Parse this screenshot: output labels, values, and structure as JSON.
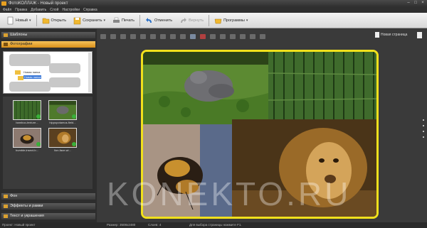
{
  "window": {
    "title": "ФотоКОЛЛАЖ - Новый проект"
  },
  "menu": [
    "Файл",
    "Правка",
    "Добавить",
    "Слой",
    "Настройки",
    "Справка"
  ],
  "toolbar": {
    "new_label": "Новый",
    "open_label": "Открыть",
    "save_label": "Сохранить",
    "print_label": "Печать",
    "undo_label": "Отменить",
    "redo_label": "Вернуть",
    "programs_label": "Программы"
  },
  "left_panel": {
    "templates_label": "Шаблоны",
    "photos_label": "Фотографии",
    "tree": {
      "node1": "Новая папка",
      "node2": "Новая папка"
    },
    "thumbnails": [
      {
        "caption": "bamboo-texture..."
      },
      {
        "caption": "hippopotamus-field..."
      },
      {
        "caption": "bumble-insect-b..."
      },
      {
        "caption": "lion-face-wi..."
      }
    ],
    "background_label": "Фон",
    "effects_label": "Эффекты и рамки",
    "text_label": "Текст и украшения"
  },
  "canvas": {
    "new_page_label": "Новая страница"
  },
  "status": {
    "project": "Проект:  Новый проект",
    "size": "Размер:  3508x2480",
    "layers": "Слоев:  4",
    "hint": "Для выбора страницы нажмите F1."
  },
  "watermark": "KONEKTO.RU",
  "colors": {
    "accent": "#f1e01c",
    "panel_active": "#f6c25a"
  }
}
